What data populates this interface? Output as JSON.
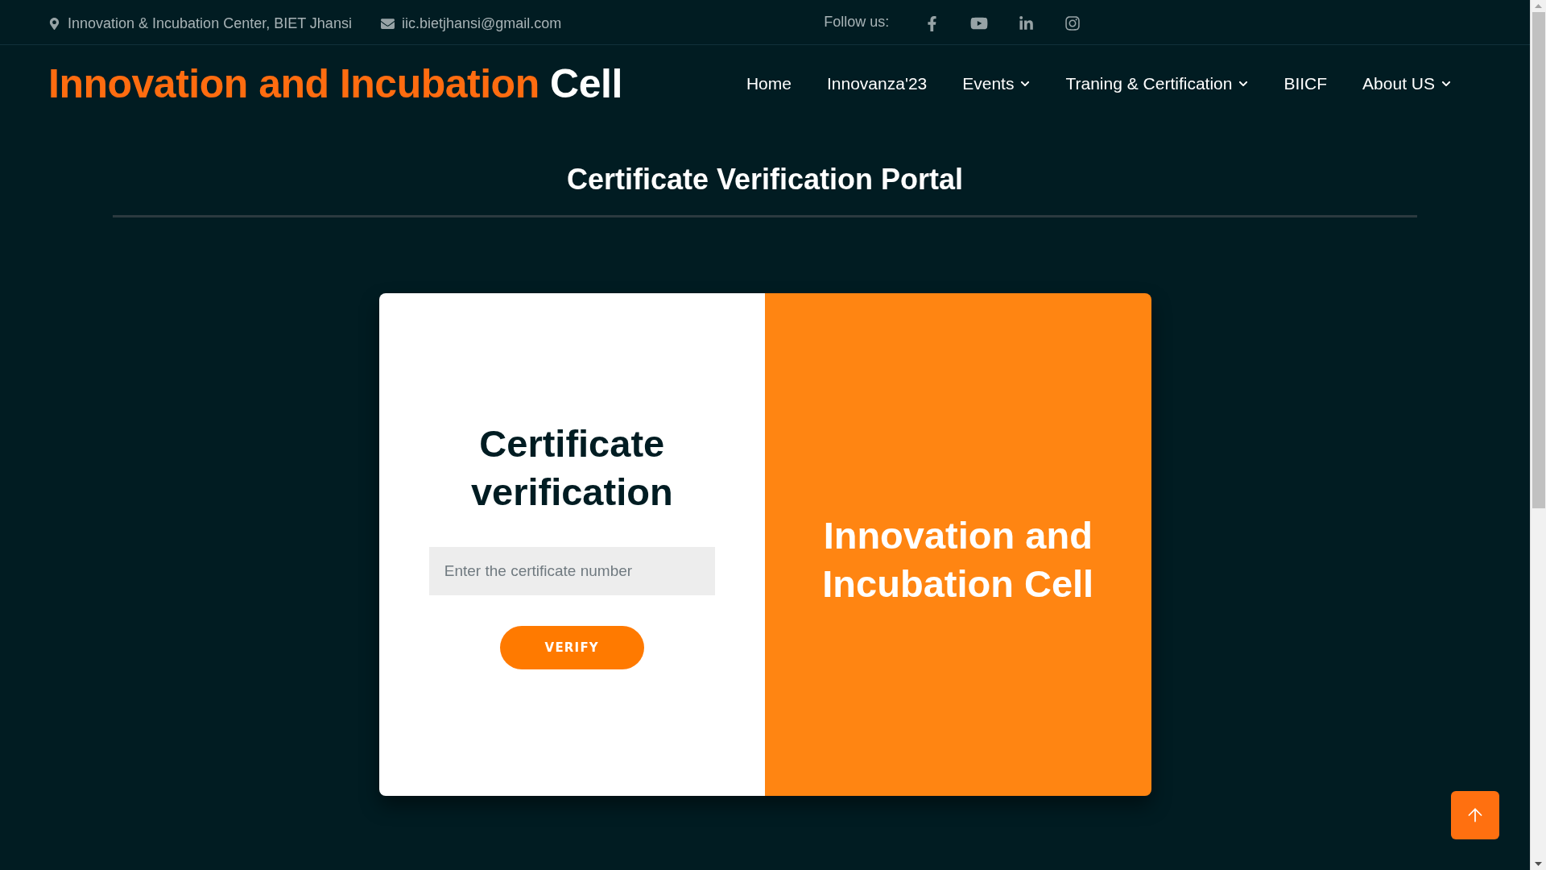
{
  "topbar": {
    "address": "Innovation & Incubation Center, BIET Jhansi",
    "email": "iic.bietjhansi@gmail.com",
    "follow_label": "Follow us:"
  },
  "navbar": {
    "logo": {
      "accent": "Innovation and Incubation",
      "rest": "Cell"
    },
    "items": [
      {
        "label": "Home",
        "dropdown": false
      },
      {
        "label": "Innovanza'23",
        "dropdown": false
      },
      {
        "label": "Events",
        "dropdown": true
      },
      {
        "label": "Traning & Certification",
        "dropdown": true
      },
      {
        "label": "BIICF",
        "dropdown": false
      },
      {
        "label": "About US",
        "dropdown": true
      }
    ]
  },
  "page_title": "Certificate Verification Portal",
  "card": {
    "heading": "Certificate verification",
    "input": {
      "placeholder": "Enter the certificate number"
    },
    "button": "VERIFY",
    "brand_text": "Innovation and Incubation Cell"
  }
}
